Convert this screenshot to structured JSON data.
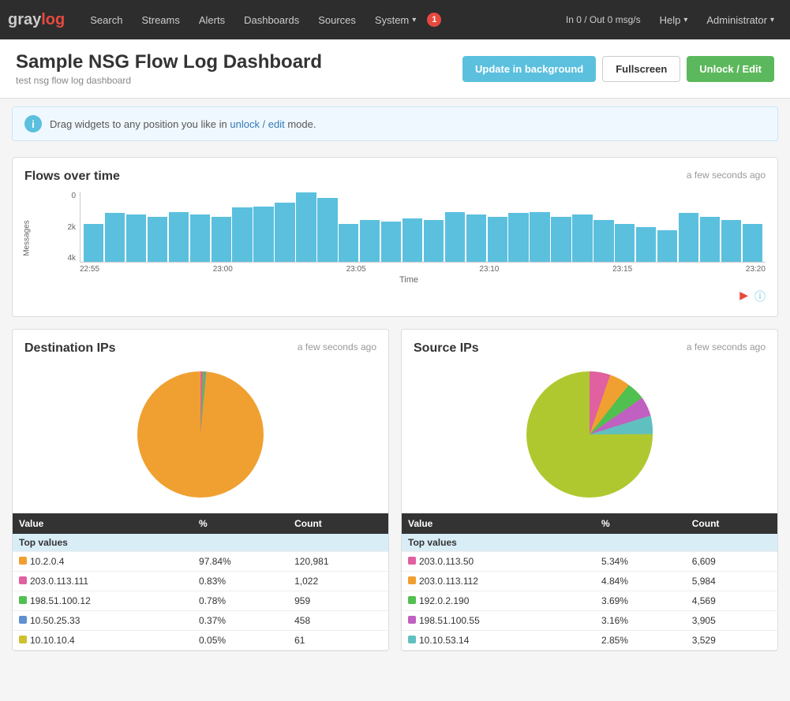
{
  "brand": {
    "gray": "gray",
    "log": "log"
  },
  "nav": {
    "links": [
      {
        "label": "Search",
        "name": "search"
      },
      {
        "label": "Streams",
        "name": "streams"
      },
      {
        "label": "Alerts",
        "name": "alerts"
      },
      {
        "label": "Dashboards",
        "name": "dashboards"
      },
      {
        "label": "Sources",
        "name": "sources"
      },
      {
        "label": "System",
        "name": "system"
      }
    ],
    "badge": "1",
    "stats": "In 0 / Out 0 msg/s",
    "help": "Help",
    "admin": "Administrator"
  },
  "header": {
    "title": "Sample NSG Flow Log Dashboard",
    "subtitle": "test nsg flow log dashboard",
    "btn_update": "Update in background",
    "btn_fullscreen": "Fullscreen",
    "btn_unlock": "Unlock / Edit"
  },
  "infobar": {
    "text": "Drag widgets to any position you like in ",
    "link": "unlock / edit",
    "text2": " mode."
  },
  "flows_chart": {
    "title": "Flows over time",
    "time": "a few seconds ago",
    "y_label": "Messages",
    "x_label": "Time",
    "y_ticks": [
      "4k",
      "2k",
      "0"
    ],
    "x_ticks": [
      "22:55",
      "23:00",
      "23:05",
      "23:10",
      "23:15",
      "23:20"
    ],
    "bars": [
      55,
      70,
      68,
      65,
      72,
      68,
      65,
      78,
      80,
      85,
      100,
      92,
      55,
      60,
      58,
      62,
      60,
      72,
      68,
      65,
      70,
      72,
      65,
      68,
      60,
      55,
      50,
      45,
      70,
      65,
      60,
      55
    ]
  },
  "dest_ips": {
    "title": "Destination IPs",
    "time": "a few seconds ago",
    "table_headers": [
      "Value",
      "%",
      "Count"
    ],
    "group_label": "Top values",
    "rows": [
      {
        "color": "#f0a030",
        "value": "10.2.0.4",
        "pct": "97.84%",
        "count": "120,981"
      },
      {
        "color": "#e060a0",
        "value": "203.0.113.111",
        "pct": "0.83%",
        "count": "1,022"
      },
      {
        "color": "#50c050",
        "value": "198.51.100.12",
        "pct": "0.78%",
        "count": "959"
      },
      {
        "color": "#6090d0",
        "value": "10.50.25.33",
        "pct": "0.37%",
        "count": "458"
      },
      {
        "color": "#d0c030",
        "value": "10.10.10.4",
        "pct": "0.05%",
        "count": "61"
      }
    ]
  },
  "source_ips": {
    "title": "Source IPs",
    "time": "a few seconds ago",
    "table_headers": [
      "Value",
      "%",
      "Count"
    ],
    "group_label": "Top values",
    "rows": [
      {
        "color": "#e060a0",
        "value": "203.0.113.50",
        "pct": "5.34%",
        "count": "6,609"
      },
      {
        "color": "#f0a030",
        "value": "203.0.113.112",
        "pct": "4.84%",
        "count": "5,984"
      },
      {
        "color": "#50c050",
        "value": "192.0.2.190",
        "pct": "3.69%",
        "count": "4,569"
      },
      {
        "color": "#c060c0",
        "value": "198.51.100.55",
        "pct": "3.16%",
        "count": "3,905"
      },
      {
        "color": "#60c0c0",
        "value": "10.10.53.14",
        "pct": "2.85%",
        "count": "3,529"
      }
    ]
  }
}
